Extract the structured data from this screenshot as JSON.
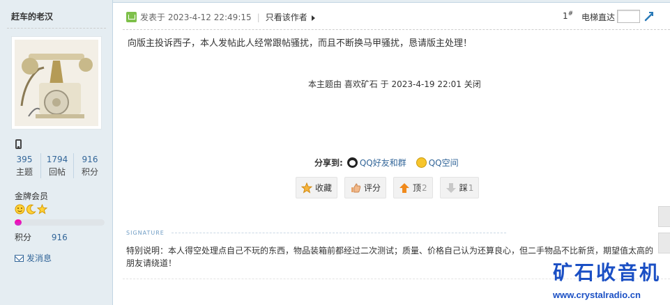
{
  "author": {
    "name": "赶车的老汉"
  },
  "stats": [
    {
      "value": "395",
      "label": "主题"
    },
    {
      "value": "1794",
      "label": "回帖"
    },
    {
      "value": "916",
      "label": "积分"
    }
  ],
  "rank": {
    "title": "金牌会员",
    "progress_percent": 8
  },
  "credit": {
    "label": "积分",
    "value": "916"
  },
  "send_message": "发消息",
  "post": {
    "posted_label": "发表于 2023-4-12 22:49:15",
    "only_author": "只看该作者",
    "floor": "1",
    "floor_mark": "#",
    "elevator_label": "电梯直达",
    "body": "向版主投诉西子，本人发帖此人经常跟帖骚扰，而且不断换马甲骚扰，恳请版主处理！",
    "closed_note": "本主题由 喜欢矿石 于 2023-4-19 22:01 关闭"
  },
  "share": {
    "label": "分享到:",
    "items": [
      "QQ好友和群",
      "QQ空间"
    ]
  },
  "actions": [
    {
      "label": "收藏",
      "count": ""
    },
    {
      "label": "评分",
      "count": ""
    },
    {
      "label": "顶",
      "count": "2"
    },
    {
      "label": "踩",
      "count": "1"
    }
  ],
  "signature": {
    "heading": "SIGNATURE",
    "text": "特别说明：本人得空处理点自己不玩的东西，物品装箱前都经过二次测试；质量、价格自己认为还算良心，但二手物品不比新货，期望值太高的朋友请绕道！"
  },
  "watermark": {
    "title": "矿石收音机",
    "url": "www.crystalradio.cn"
  },
  "colors": {
    "link": "#336699",
    "sidebar": "#e5edf2",
    "watermark": "#1a4fc4"
  }
}
